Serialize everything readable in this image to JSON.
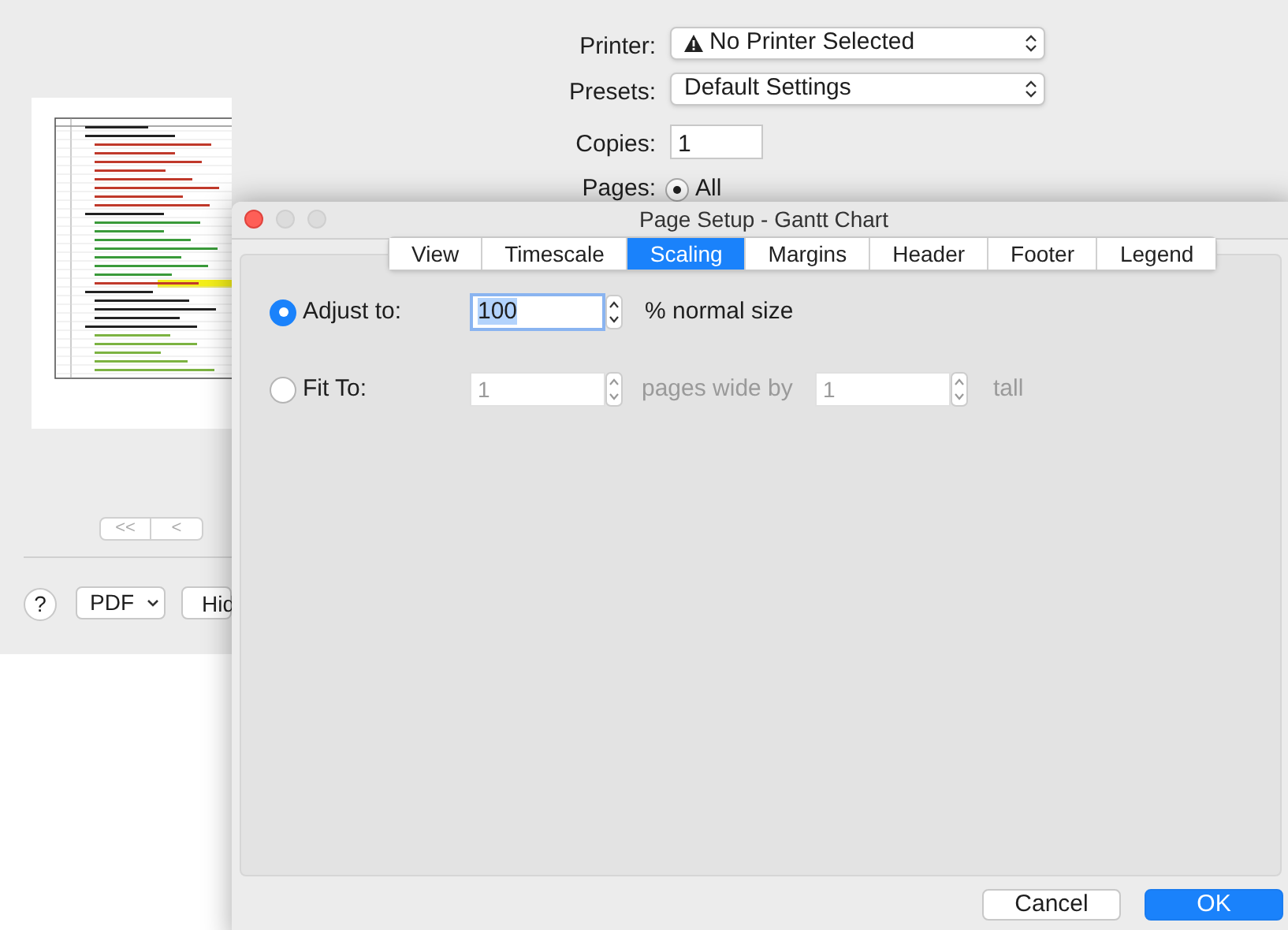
{
  "print_dialog": {
    "printer": {
      "label": "Printer:",
      "value": "No Printer Selected",
      "warning": true
    },
    "presets": {
      "label": "Presets:",
      "value": "Default Settings"
    },
    "copies": {
      "label": "Copies:",
      "value": "1"
    },
    "pages": {
      "label": "Pages:",
      "options": [
        {
          "label": "All",
          "selected": true
        }
      ]
    },
    "page_nav": [
      "<<",
      "<"
    ],
    "help": "?",
    "pdf_menu": "PDF",
    "hide_button": "Hid"
  },
  "page_setup": {
    "title": "Page Setup - Gantt Chart",
    "tabs": [
      {
        "label": "View",
        "selected": false
      },
      {
        "label": "Timescale",
        "selected": false
      },
      {
        "label": "Scaling",
        "selected": true
      },
      {
        "label": "Margins",
        "selected": false
      },
      {
        "label": "Header",
        "selected": false
      },
      {
        "label": "Footer",
        "selected": false
      },
      {
        "label": "Legend",
        "selected": false
      }
    ],
    "adjust_to": {
      "label": "Adjust to:",
      "selected": true,
      "value": "100",
      "suffix": "% normal size"
    },
    "fit_to": {
      "label": "Fit To:",
      "selected": false,
      "wide_value": "1",
      "wide_label": "pages wide by",
      "tall_value": "1",
      "tall_label": "tall"
    },
    "buttons": [
      {
        "label": "Cancel",
        "default": false
      },
      {
        "label": "OK",
        "default": true
      }
    ]
  }
}
